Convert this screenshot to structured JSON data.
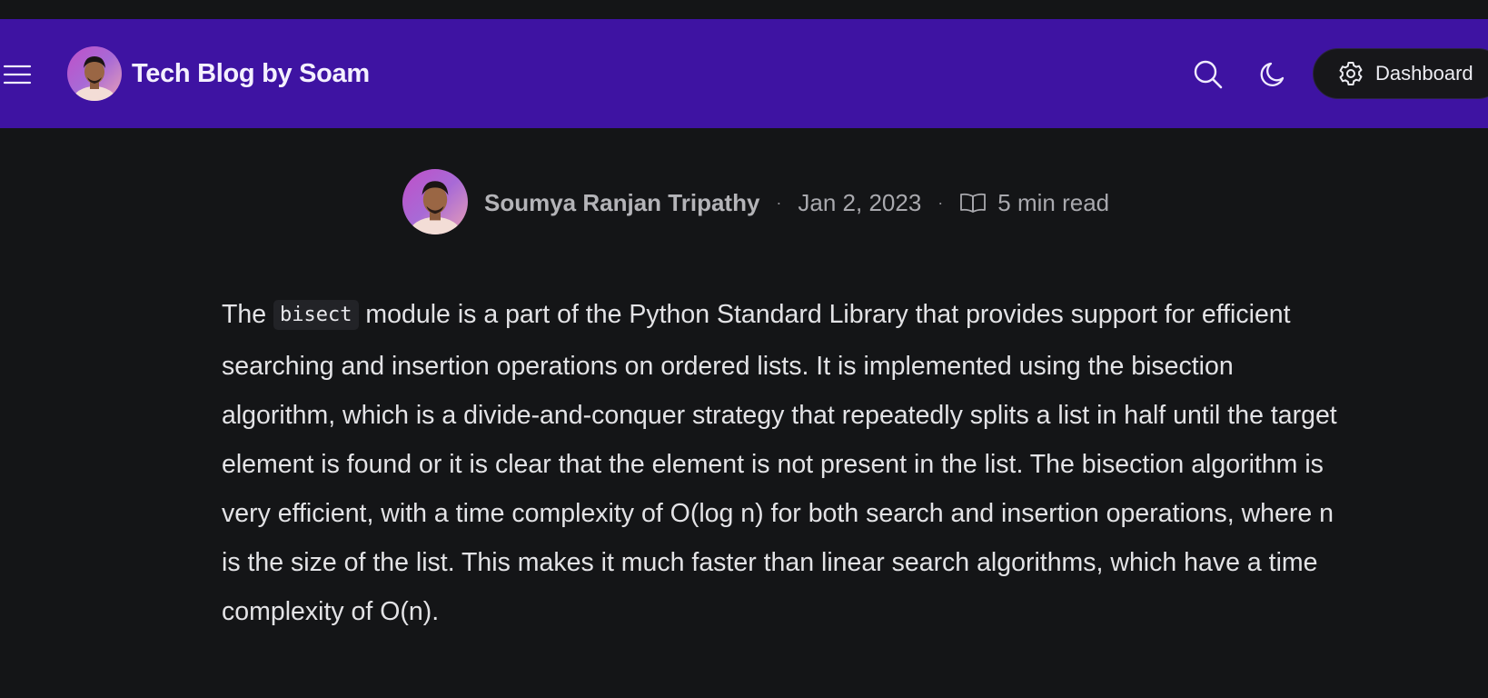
{
  "header": {
    "brand_title": "Tech Blog by Soam",
    "dashboard_label": "Dashboard",
    "icons": [
      "menu-icon",
      "search-icon",
      "moon-icon",
      "gear-icon"
    ]
  },
  "post_meta": {
    "author": "Soumya Ranjan Tripathy",
    "separator": "·",
    "date": "Jan 2, 2023",
    "read_time": "5 min read",
    "icons": [
      "book-icon"
    ]
  },
  "article": {
    "p1_before_code": "The ",
    "p1_code": "bisect",
    "p1_after_code": " module is a part of the Python Standard Library that provides support for efficient searching and insertion operations on ordered lists. It is implemented using the bisection algorithm, which is a divide-and-conquer strategy that repeatedly splits a list in half until the target element is found or it is clear that the element is not present in the list. The bisection algorithm is very efficient, with a time complexity of O(log n) for both search and insertion operations, where n is the size of the list. This makes it much faster than linear search algorithms, which have a time complexity of O(n)."
  },
  "colors": {
    "header_bg": "#3e13a2",
    "page_bg": "#141517",
    "body_text": "#e3e3e6",
    "meta_text": "#a9a9ae"
  }
}
